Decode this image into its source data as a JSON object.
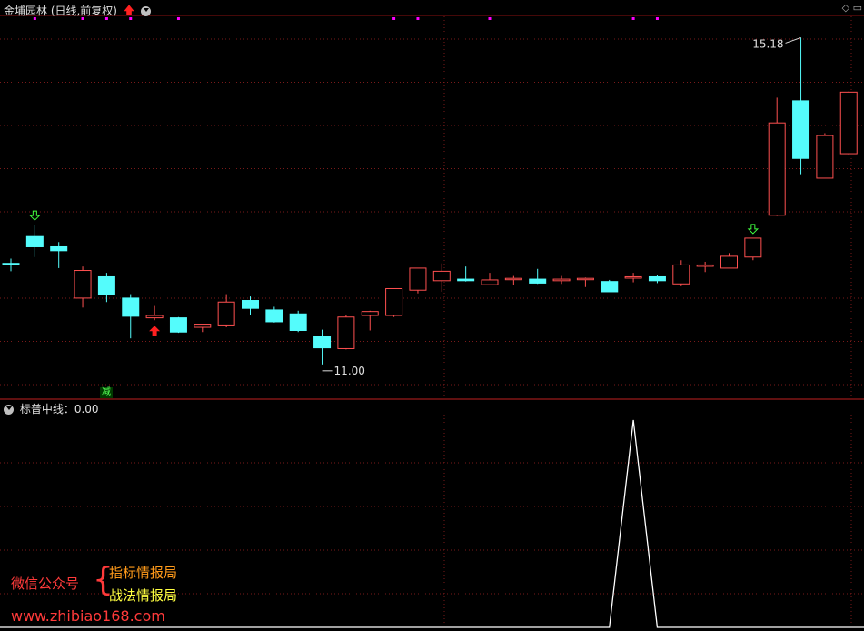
{
  "main_panel": {
    "title": "金埔园林 (日线,前复权)",
    "high_label": "15.18",
    "low_label": "11.00",
    "signal_text": "减"
  },
  "sub_panel": {
    "title": "标普中线：0.00"
  },
  "watermark": {
    "account_label": "微信公众号",
    "brace": "{",
    "line1": "指标情报局",
    "line2": "战法情报局",
    "url": "www.zhibiao168.com"
  },
  "colors": {
    "up": "#ff5050",
    "down": "#54fcfc",
    "grid": "#7a1a1a",
    "signal_dot": "#ff00ff",
    "buy_arrow": "#ff2020",
    "sell_arrow": "#40ff40"
  },
  "chart_data": {
    "type": "candlestick",
    "title": "金埔园林 (日线,前复权)",
    "y_range": [
      10.75,
      15.45
    ],
    "candles": [
      {
        "o": 12.32,
        "h": 12.38,
        "l": 12.22,
        "c": 12.3
      },
      {
        "o": 12.66,
        "h": 12.81,
        "l": 12.4,
        "c": 12.53
      },
      {
        "o": 12.53,
        "h": 12.59,
        "l": 12.26,
        "c": 12.48
      },
      {
        "o": 11.88,
        "h": 12.28,
        "l": 11.76,
        "c": 12.23
      },
      {
        "o": 12.15,
        "h": 12.2,
        "l": 11.83,
        "c": 11.92
      },
      {
        "o": 11.88,
        "h": 11.93,
        "l": 11.37,
        "c": 11.65
      },
      {
        "o": 11.63,
        "h": 11.78,
        "l": 11.6,
        "c": 11.66
      },
      {
        "o": 11.63,
        "h": 11.64,
        "l": 11.44,
        "c": 11.45
      },
      {
        "o": 11.51,
        "h": 11.55,
        "l": 11.45,
        "c": 11.55
      },
      {
        "o": 11.54,
        "h": 11.93,
        "l": 11.51,
        "c": 11.83
      },
      {
        "o": 11.85,
        "h": 11.9,
        "l": 11.67,
        "c": 11.75
      },
      {
        "o": 11.73,
        "h": 11.77,
        "l": 11.57,
        "c": 11.58
      },
      {
        "o": 11.68,
        "h": 11.72,
        "l": 11.45,
        "c": 11.47
      },
      {
        "o": 11.4,
        "h": 11.48,
        "l": 11.04,
        "c": 11.25
      },
      {
        "o": 11.24,
        "h": 11.66,
        "l": 11.23,
        "c": 11.64
      },
      {
        "o": 11.66,
        "h": 11.72,
        "l": 11.47,
        "c": 11.71
      },
      {
        "o": 11.66,
        "h": 12.0,
        "l": 11.64,
        "c": 12.0
      },
      {
        "o": 11.98,
        "h": 12.26,
        "l": 11.94,
        "c": 12.26
      },
      {
        "o": 12.1,
        "h": 12.32,
        "l": 11.96,
        "c": 12.22
      },
      {
        "o": 12.12,
        "h": 12.28,
        "l": 12.09,
        "c": 12.1
      },
      {
        "o": 12.05,
        "h": 12.2,
        "l": 12.05,
        "c": 12.11
      },
      {
        "o": 12.13,
        "h": 12.16,
        "l": 12.04,
        "c": 12.13
      },
      {
        "o": 12.12,
        "h": 12.25,
        "l": 12.06,
        "c": 12.07
      },
      {
        "o": 12.1,
        "h": 12.16,
        "l": 12.06,
        "c": 12.12
      },
      {
        "o": 12.12,
        "h": 12.14,
        "l": 12.02,
        "c": 12.13
      },
      {
        "o": 12.09,
        "h": 12.11,
        "l": 11.96,
        "c": 11.96
      },
      {
        "o": 12.15,
        "h": 12.2,
        "l": 12.08,
        "c": 12.15
      },
      {
        "o": 12.15,
        "h": 12.17,
        "l": 12.07,
        "c": 12.1
      },
      {
        "o": 12.06,
        "h": 12.36,
        "l": 12.03,
        "c": 12.3
      },
      {
        "o": 12.3,
        "h": 12.34,
        "l": 12.21,
        "c": 12.3
      },
      {
        "o": 12.26,
        "h": 12.45,
        "l": 12.26,
        "c": 12.41
      },
      {
        "o": 12.4,
        "h": 12.64,
        "l": 12.36,
        "c": 12.64
      },
      {
        "o": 12.93,
        "h": 14.42,
        "l": 12.92,
        "c": 14.1
      },
      {
        "o": 14.38,
        "h": 15.18,
        "l": 13.45,
        "c": 13.65
      },
      {
        "o": 13.4,
        "h": 13.97,
        "l": 13.4,
        "c": 13.94
      },
      {
        "o": 13.71,
        "h": 14.5,
        "l": 13.7,
        "c": 14.49
      }
    ],
    "buy_signal_index": [
      6
    ],
    "sell_signal_index": [
      1,
      31
    ],
    "signal_dot_index": [
      1,
      3,
      4,
      5,
      7,
      16,
      17,
      20,
      26,
      27
    ],
    "sub_indicator": {
      "name": "标普中线",
      "value": 0.0,
      "values": [
        0,
        0,
        0,
        0,
        0,
        0,
        0,
        0,
        0,
        0,
        0,
        0,
        0,
        0,
        0,
        0,
        0,
        0,
        0,
        0,
        0,
        0,
        0,
        0,
        0,
        0,
        1,
        0,
        0,
        0,
        0,
        0,
        0,
        0,
        0,
        0
      ],
      "y_range": [
        0,
        1
      ]
    }
  }
}
